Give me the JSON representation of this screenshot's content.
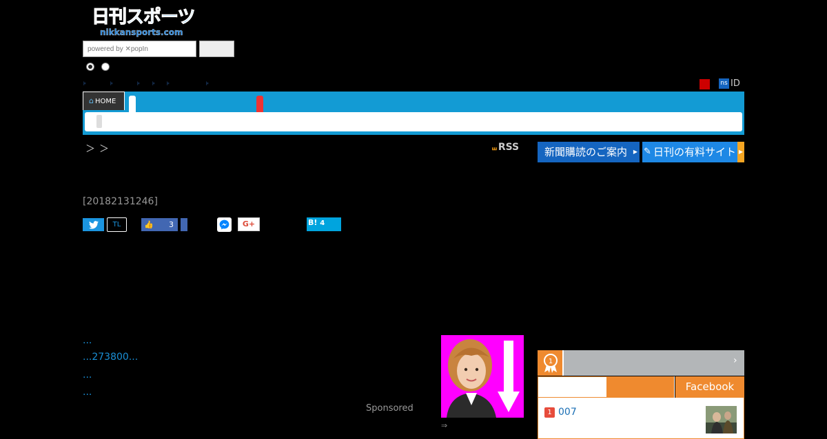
{
  "logo": {
    "ja": "日刊スポーツ",
    "en": "nikkansports.com"
  },
  "search": {
    "placeholder": "powered by ✕popIn",
    "button_label": ""
  },
  "nav": {
    "arrows": [
      "⊧",
      "⊧",
      "⊧",
      "⊧",
      "⊧",
      "⊧"
    ],
    "ns_badge": "ns",
    "id_label": "ID",
    "home_label": "HOME"
  },
  "breadcrumb": "＞＞",
  "header_links": {
    "rss": "RSS",
    "newspaper": "新聞購読のご案内",
    "paid_site": "日刊の有料サイト"
  },
  "article": {
    "timestamp": "[20182131246]"
  },
  "social": {
    "twitter_icon": "twitter-bird",
    "tl": "TL",
    "fb_like_count": "3",
    "gplus": "G+",
    "hatena": "B!",
    "hatena_count": "4"
  },
  "related": [
    "...",
    "...273800...",
    "...",
    "..."
  ],
  "ad": {
    "sponsored": "Sponsored",
    "arrow": "⇒"
  },
  "ranking": {
    "tab_facebook": "Facebook",
    "chevron": "›",
    "items": [
      {
        "rank": "1",
        "title": "007"
      }
    ]
  },
  "colors": {
    "nav_blue": "#139bd4",
    "ranking_orange": "#ef8a2f",
    "link_blue": "#1a8fd6",
    "ad_magenta": "#ff00ff"
  }
}
